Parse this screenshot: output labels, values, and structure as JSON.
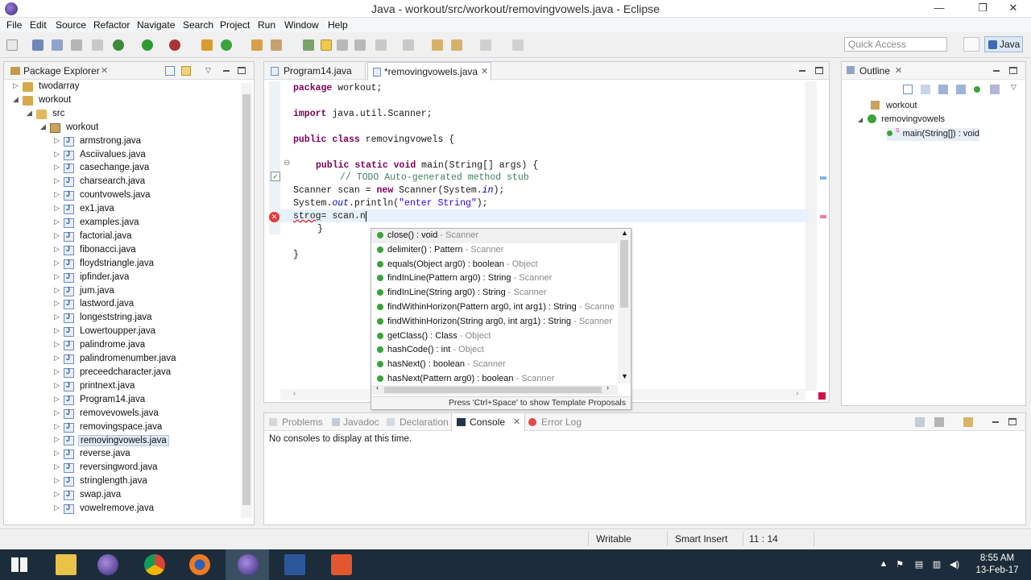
{
  "window": {
    "title": "Java - workout/src/workout/removingvowels.java - Eclipse"
  },
  "menu": [
    "File",
    "Edit",
    "Source",
    "Refactor",
    "Navigate",
    "Search",
    "Project",
    "Run",
    "Window",
    "Help"
  ],
  "toolbar": {
    "quick_access_placeholder": "Quick Access",
    "perspective": "Java"
  },
  "package_explorer": {
    "title": "Package Explorer",
    "tree": [
      {
        "label": "twodarray",
        "type": "project",
        "depth": 0,
        "arrow": "▷"
      },
      {
        "label": "workout",
        "type": "project",
        "depth": 0,
        "arrow": "◢"
      },
      {
        "label": "src",
        "type": "folder",
        "depth": 1,
        "arrow": "◢"
      },
      {
        "label": "workout",
        "type": "pkg",
        "depth": 2,
        "arrow": "◢"
      },
      {
        "label": "armstrong.java",
        "type": "file",
        "depth": 3,
        "arrow": "▷"
      },
      {
        "label": "Asciivalues.java",
        "type": "file",
        "depth": 3,
        "arrow": "▷"
      },
      {
        "label": "casechange.java",
        "type": "file",
        "depth": 3,
        "arrow": "▷"
      },
      {
        "label": "charsearch.java",
        "type": "file",
        "depth": 3,
        "arrow": "▷"
      },
      {
        "label": "countvowels.java",
        "type": "file",
        "depth": 3,
        "arrow": "▷"
      },
      {
        "label": "ex1.java",
        "type": "file",
        "depth": 3,
        "arrow": "▷"
      },
      {
        "label": "examples.java",
        "type": "file",
        "depth": 3,
        "arrow": "▷"
      },
      {
        "label": "factorial.java",
        "type": "file",
        "depth": 3,
        "arrow": "▷"
      },
      {
        "label": "fibonacci.java",
        "type": "file",
        "depth": 3,
        "arrow": "▷"
      },
      {
        "label": "floydstriangle.java",
        "type": "file",
        "depth": 3,
        "arrow": "▷"
      },
      {
        "label": "ipfinder.java",
        "type": "file",
        "depth": 3,
        "arrow": "▷"
      },
      {
        "label": "jum.java",
        "type": "file",
        "depth": 3,
        "arrow": "▷"
      },
      {
        "label": "lastword.java",
        "type": "file",
        "depth": 3,
        "arrow": "▷"
      },
      {
        "label": "longeststring.java",
        "type": "file",
        "depth": 3,
        "arrow": "▷"
      },
      {
        "label": "Lowertoupper.java",
        "type": "file",
        "depth": 3,
        "arrow": "▷"
      },
      {
        "label": "palindrome.java",
        "type": "file",
        "depth": 3,
        "arrow": "▷"
      },
      {
        "label": "palindromenumber.java",
        "type": "file",
        "depth": 3,
        "arrow": "▷"
      },
      {
        "label": "preceedcharacter.java",
        "type": "file",
        "depth": 3,
        "arrow": "▷"
      },
      {
        "label": "printnext.java",
        "type": "file",
        "depth": 3,
        "arrow": "▷"
      },
      {
        "label": "Program14.java",
        "type": "file",
        "depth": 3,
        "arrow": "▷"
      },
      {
        "label": "removevowels.java",
        "type": "file",
        "depth": 3,
        "arrow": "▷"
      },
      {
        "label": "removingspace.java",
        "type": "file",
        "depth": 3,
        "arrow": "▷"
      },
      {
        "label": "removingvowels.java",
        "type": "file",
        "depth": 3,
        "arrow": "▷",
        "selected": true
      },
      {
        "label": "reverse.java",
        "type": "file",
        "depth": 3,
        "arrow": "▷"
      },
      {
        "label": "reversingword.java",
        "type": "file",
        "depth": 3,
        "arrow": "▷"
      },
      {
        "label": "stringlength.java",
        "type": "file",
        "depth": 3,
        "arrow": "▷"
      },
      {
        "label": "swap.java",
        "type": "file",
        "depth": 3,
        "arrow": "▷"
      },
      {
        "label": "vowelremove.java",
        "type": "file",
        "depth": 3,
        "arrow": "▷"
      }
    ]
  },
  "editor": {
    "tabs": [
      {
        "label": "Program14.java",
        "active": false
      },
      {
        "label": "*removingvowels.java",
        "active": true
      }
    ],
    "cursor_line_index": 8
  },
  "content_assist": {
    "items": [
      {
        "sig": "close() : void",
        "owner": "Scanner",
        "selected": true
      },
      {
        "sig": "delimiter() : Pattern",
        "owner": "Scanner"
      },
      {
        "sig": "equals(Object arg0) : boolean",
        "owner": "Object"
      },
      {
        "sig": "findInLine(Pattern arg0) : String",
        "owner": "Scanner"
      },
      {
        "sig": "findInLine(String arg0) : String",
        "owner": "Scanner"
      },
      {
        "sig": "findWithinHorizon(Pattern arg0, int arg1) : String",
        "owner": "Scanne"
      },
      {
        "sig": "findWithinHorizon(String arg0, int arg1) : String",
        "owner": "Scanner"
      },
      {
        "sig": "getClass() : Class",
        "owner": "Object"
      },
      {
        "sig": "hashCode() : int",
        "owner": "Object"
      },
      {
        "sig": "hasNext() : boolean",
        "owner": "Scanner"
      },
      {
        "sig": "hasNext(Pattern arg0) : boolean",
        "owner": "Scanner"
      }
    ],
    "hint": "Press 'Ctrl+Space' to show Template Proposals"
  },
  "outline": {
    "title": "Outline",
    "items": [
      {
        "label": "workout",
        "depth": 0
      },
      {
        "label": "removingvowels",
        "depth": 1
      },
      {
        "label": "main(String[]) : void",
        "depth": 2,
        "badge": "S"
      }
    ]
  },
  "bottom": {
    "tabs": [
      "Problems",
      "Javadoc",
      "Declaration",
      "Console",
      "Error Log"
    ],
    "active_tab": "Console",
    "console_message": "No consoles to display at this time."
  },
  "status": {
    "writable": "Writable",
    "insert_mode": "Smart Insert",
    "position": "11 : 14"
  },
  "taskbar": {
    "time": "8:55 AM",
    "date": "13-Feb-17"
  },
  "colors": {
    "keyword": "#7f0055",
    "comment": "#3f7f5f",
    "string": "#2a00ff",
    "field": "#0000c0",
    "taskbar": "#1c2c3a"
  }
}
